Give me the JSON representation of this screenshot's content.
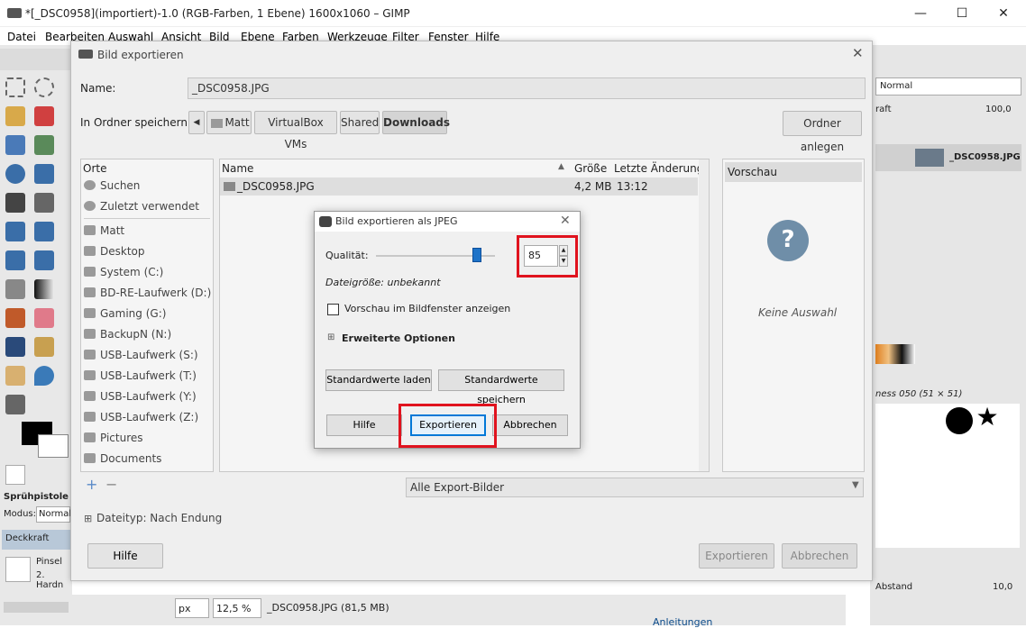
{
  "window": {
    "title": "*[_DSC0958](importiert)-1.0 (RGB-Farben, 1 Ebene) 1600x1060 – GIMP",
    "minimize": "—",
    "maximize": "☐",
    "close": "✕"
  },
  "menubar": [
    "Datei",
    "Bearbeiten",
    "Auswahl",
    "Ansicht",
    "Bild",
    "Ebene",
    "Farben",
    "Werkzeuge",
    "Filter",
    "Fenster",
    "Hilfe"
  ],
  "tool_options": {
    "tool_name": "Sprühpistole",
    "mode_label": "Modus:",
    "mode_value": "Normal",
    "opacity_label": "Deckkraft",
    "brush_label": "Pinsel",
    "brush_value": "2. Hardn"
  },
  "right_dock": {
    "mode_value": "Normal",
    "opacity_label": "raft",
    "opacity_value": "100,0",
    "layer_name": "_DSC0958.JPG",
    "brush_title": "ness 050 (51 × 51)",
    "spacing_label": "Abstand",
    "spacing_value": "10,0"
  },
  "status_bar": {
    "unit": "px",
    "zoom": "12,5 %",
    "file_info": "_DSC0958.JPG (81,5 MB)",
    "cut_text": "Anleitungen"
  },
  "export_dialog": {
    "title": "Bild exportieren",
    "name_label": "Name:",
    "name_value": "_DSC0958.JPG",
    "folder_label": "In Ordner speichern:",
    "path": [
      "Matt",
      "VirtualBox VMs",
      "Shared",
      "Downloads"
    ],
    "create_folder": "Ordner anlegen",
    "places_header": "Orte",
    "places": [
      "Suchen",
      "Zuletzt verwendet",
      "Matt",
      "Desktop",
      "System (C:)",
      "BD-RE-Laufwerk (D:)",
      "Gaming (G:)",
      "BackupN (N:)",
      "USB-Laufwerk (S:)",
      "USB-Laufwerk (T:)",
      "USB-Laufwerk (Y:)",
      "USB-Laufwerk (Z:)",
      "Pictures",
      "Documents"
    ],
    "col_name": "Name",
    "col_size": "Größe",
    "col_modified": "Letzte Änderung",
    "files": [
      {
        "name": "_DSC0958.JPG",
        "size": "4,2 MB",
        "modified": "13:12"
      }
    ],
    "preview_title": "Vorschau",
    "no_selection": "Keine Auswahl",
    "filter": "Alle Export-Bilder",
    "filetype": "Dateityp: Nach Endung",
    "help": "Hilfe",
    "export": "Exportieren",
    "cancel": "Abbrechen"
  },
  "jpeg_dialog": {
    "title": "Bild exportieren als JPEG",
    "quality_label": "Qualität:",
    "quality_value": "85",
    "quality_percent": 85,
    "filesize": "Dateigröße: unbekannt",
    "preview_checkbox": "Vorschau im Bildfenster anzeigen",
    "advanced": "Erweiterte Optionen",
    "load_defaults": "Standardwerte laden",
    "save_defaults": "Standardwerte speichern",
    "help": "Hilfe",
    "export": "Exportieren",
    "cancel": "Abbrechen"
  },
  "colors": {
    "highlight": "#e0131e",
    "accent": "#1e73c8"
  }
}
